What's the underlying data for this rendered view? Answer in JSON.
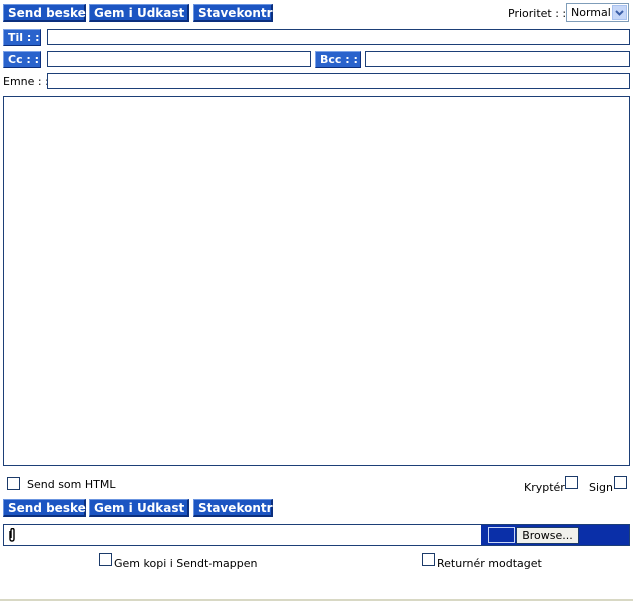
{
  "toolbar": {
    "send_label": "Send besked",
    "draft_label": "Gem i Udkast",
    "spell_label": "Stavekontrol"
  },
  "priority": {
    "label": "Prioritet : :",
    "selected": "Normal"
  },
  "fields": {
    "to_label": "Til : :",
    "cc_label": "Cc : :",
    "bcc_label": "Bcc : :",
    "subject_label": "Emne : :",
    "to_value": "",
    "cc_value": "",
    "bcc_value": "",
    "subject_value": "",
    "body_value": ""
  },
  "options": {
    "html_label": "Send som HTML",
    "encrypt_label": "Kryptér",
    "sign_label": "Sign"
  },
  "attachment": {
    "file_value": "",
    "browse_label": "Browse...",
    "icon": "paperclip-icon"
  },
  "footer": {
    "save_copy_label": "Gem kopi i Sendt-mappen",
    "receipt_label": "Returnér modtaget"
  },
  "colors": {
    "button_bg": "#1c55c2",
    "border_dark": "#1d3f77",
    "attach_bar": "#0a2fa8"
  }
}
